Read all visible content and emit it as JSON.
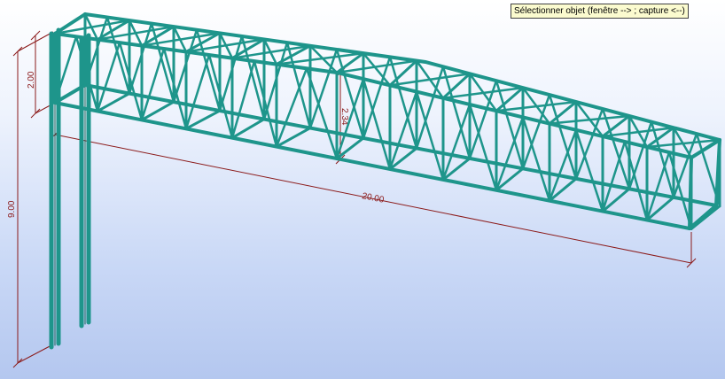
{
  "tooltip": {
    "text": "Sélectionner objet (fenêtre --> ; capture <--)"
  },
  "model": {
    "structure_color": "#1f9a90",
    "dimension_color": "#8b1a1a",
    "background_top": "#ffffff",
    "background_bottom": "#b4c7ef"
  },
  "dimensions": {
    "column_height": "9.00",
    "top_offset": "2.00",
    "truss_depth": "2.34",
    "span_length": "20.00"
  }
}
